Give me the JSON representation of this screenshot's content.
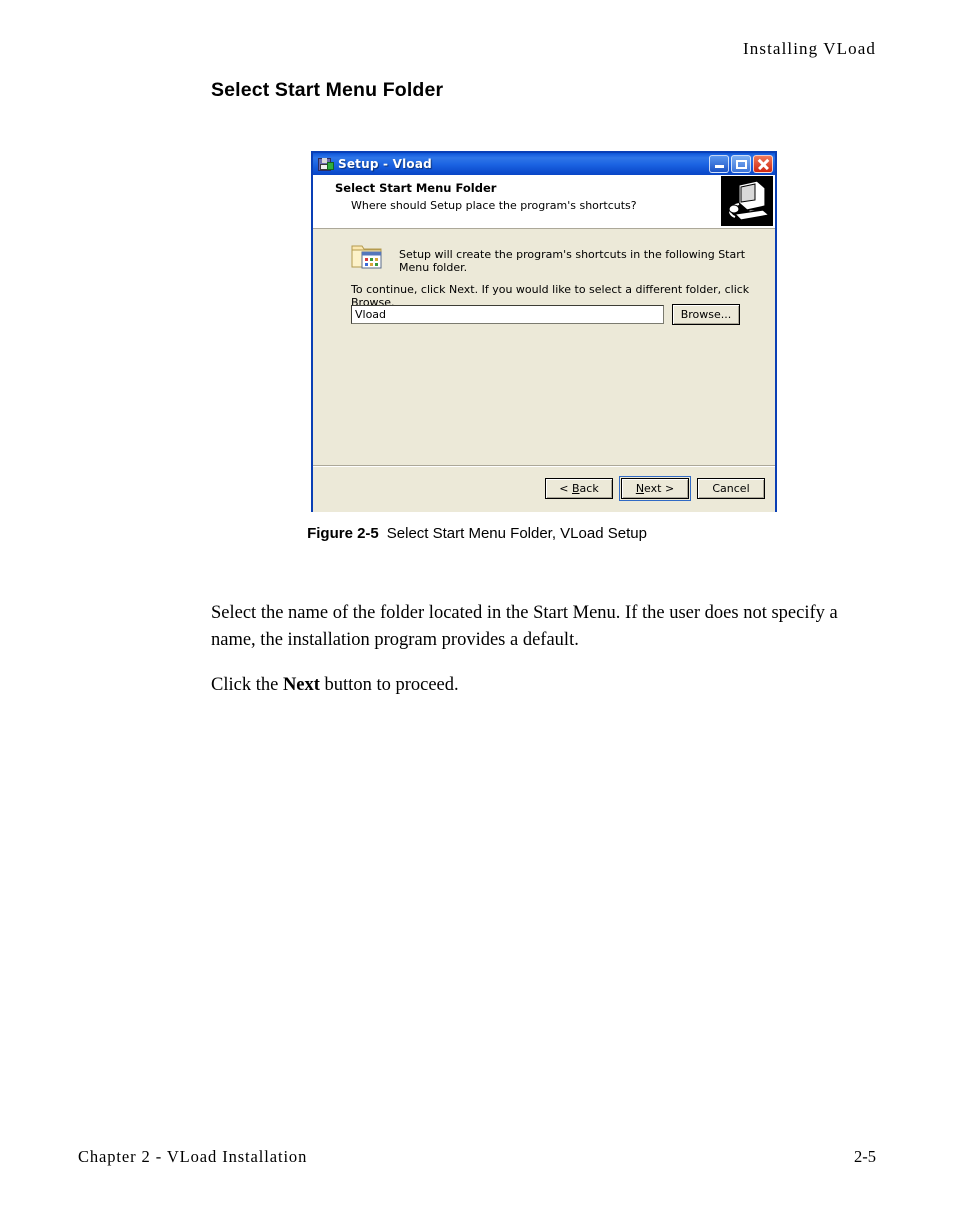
{
  "page": {
    "running_head": "Installing VLoad",
    "section_heading": "Select Start Menu Folder",
    "footer_left": "Chapter 2 - VLoad Installation",
    "footer_right": "2-5"
  },
  "figure": {
    "number": "Figure 2-5",
    "caption": "Select Start Menu Folder, VLoad Setup"
  },
  "dialog": {
    "title": "Setup - Vload",
    "title_icon": "setup-disk-icon",
    "window_controls": [
      {
        "name": "minimize",
        "glyph": "_"
      },
      {
        "name": "maximize",
        "glyph": "□"
      },
      {
        "name": "close",
        "glyph": "✕"
      }
    ],
    "header": {
      "heading": "Select Start Menu Folder",
      "subheading": "Where should Setup place the program's shortcuts?",
      "art": "computer-monitor-icon"
    },
    "body": {
      "folder_icon": "start-menu-folder-icon",
      "line1": "Setup will create the program's shortcuts in the following Start Menu folder.",
      "line2": "To continue, click Next. If you would like to select a different folder, click Browse.",
      "folder_field_value": "Vload",
      "folder_field_placeholder": "Vload",
      "browse_label": "Browse..."
    },
    "footer": {
      "back_label_pre": "< ",
      "back_label_key": "B",
      "back_label_post": "ack",
      "next_label_pre": "",
      "next_label_key": "N",
      "next_label_post": "ext >",
      "cancel_label": "Cancel"
    },
    "colors": {
      "titlebar_blue": "#0a54d6",
      "window_face": "#ece9d8",
      "border_blue": "#0a3fb5",
      "close_red": "#cf2510",
      "field_white": "#ffffff"
    }
  },
  "prose": {
    "paragraph1": "Select the name of the folder located in the Start Menu.  If the user does not specify a name, the installation program provides a default.",
    "p2_pre": "Click the ",
    "p2_bold": "Next",
    "p2_post": " button to proceed."
  }
}
